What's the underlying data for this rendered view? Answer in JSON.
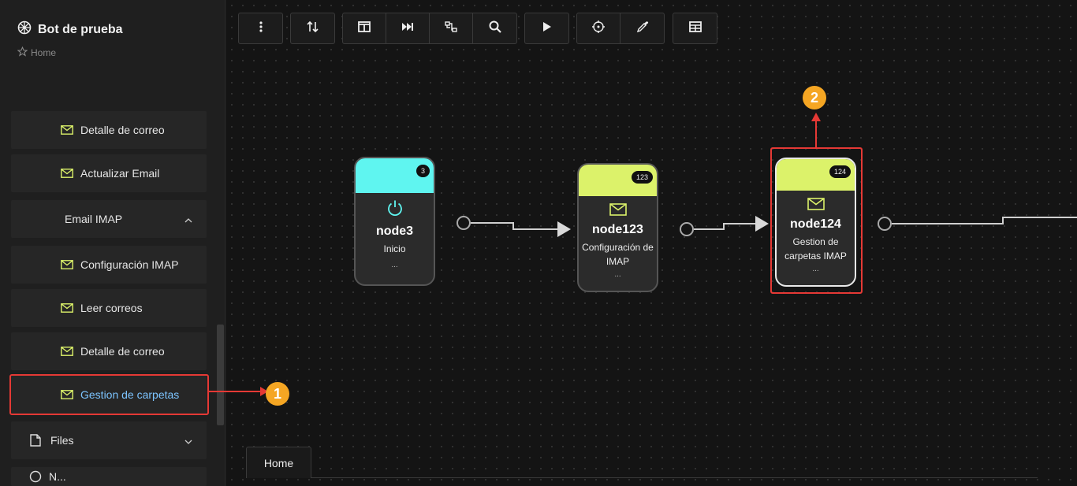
{
  "app": {
    "title": "Bot de prueba",
    "breadcrumb": "Home"
  },
  "sidebar": {
    "items": [
      {
        "label": "Detalle de correo",
        "icon": "mail-icon"
      },
      {
        "label": "Actualizar Email",
        "icon": "mail-icon"
      },
      {
        "label": "Email IMAP",
        "icon": "chevron-up-icon"
      },
      {
        "label": "Configuración IMAP",
        "icon": "mail-icon"
      },
      {
        "label": "Leer correos",
        "icon": "mail-icon"
      },
      {
        "label": "Detalle de correo",
        "icon": "mail-icon"
      },
      {
        "label": "Gestion de carpetas",
        "icon": "mail-icon"
      },
      {
        "label": "Files",
        "icon": "file-icon"
      },
      {
        "label": "N...",
        "icon": "globe-icon"
      }
    ]
  },
  "toolbar": {
    "buttons": [
      "more-vert-icon",
      "sort-icon",
      "layout-icon",
      "skip-icon",
      "connect-icon",
      "search-icon",
      "play-icon",
      "target-icon",
      "eyedropper-icon",
      "table-icon"
    ]
  },
  "nodes": [
    {
      "title": "node3",
      "subtitle": "Inicio",
      "badge": "3",
      "more": "...",
      "color": "#5ff5f0"
    },
    {
      "title": "node123",
      "subtitle": "Configuración de IMAP",
      "badge": "123",
      "more": "...",
      "color": "#dcf26a"
    },
    {
      "title": "node124",
      "subtitle": "Gestion de carpetas IMAP",
      "badge": "124",
      "more": "...",
      "color": "#dcf26a"
    }
  ],
  "markers": [
    "1",
    "2"
  ],
  "tabs": [
    {
      "label": "Home"
    }
  ],
  "colors": {
    "accent_red": "#e53935",
    "marker": "#f5a623",
    "active_link": "#7cc4ff",
    "mail_icon": "#dcf26a"
  }
}
